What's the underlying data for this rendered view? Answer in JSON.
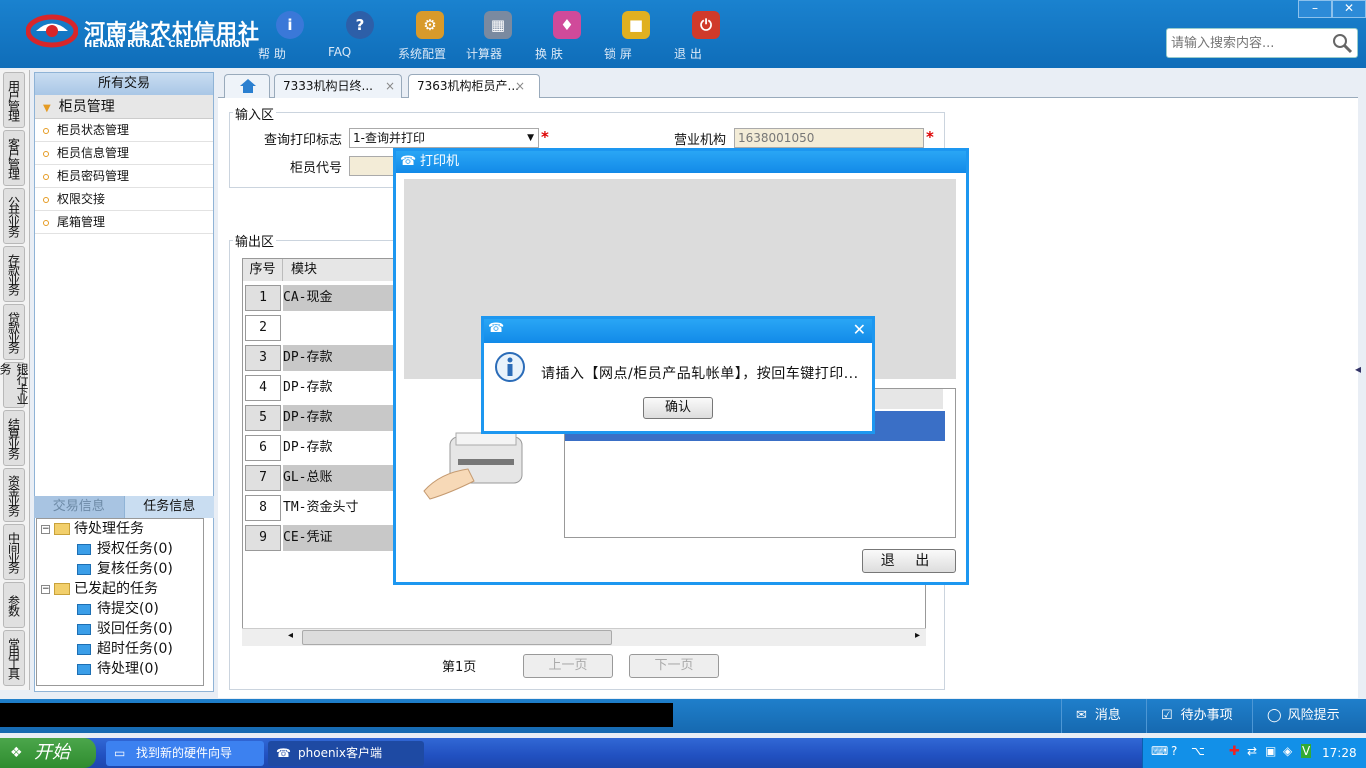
{
  "header": {
    "logo_cn": "河南省农村信用社",
    "logo_en": "HENAN RURAL CREDIT UNION",
    "tools": [
      {
        "label": "帮 助",
        "icon": "info-icon",
        "color": "#3a78d8"
      },
      {
        "label": "FAQ",
        "icon": "question-icon",
        "color": "#2d5fa8"
      },
      {
        "label": "系统配置",
        "icon": "toolbox-icon",
        "color": "#d89a2a"
      },
      {
        "label": "计算器",
        "icon": "calculator-icon",
        "color": "#7a8aa0"
      },
      {
        "label": "换 肤",
        "icon": "shirt-icon",
        "color": "#d04a9a"
      },
      {
        "label": "锁 屏",
        "icon": "lock-icon",
        "color": "#e0b020"
      },
      {
        "label": "退 出",
        "icon": "power-icon",
        "color": "#d03a2a"
      }
    ],
    "search_placeholder": "请输入搜索内容...",
    "min_label": "–",
    "close_label": "✕"
  },
  "vnav": [
    "用户管理",
    "客户管理",
    "公共业务",
    "存款业务",
    "贷款业务",
    "银行卡业务",
    "结算业务",
    "资金业务",
    "中间业务",
    "参数",
    "常用工具"
  ],
  "left_panel": {
    "title": "所有交易",
    "group": "柜员管理",
    "items": [
      "柜员状态管理",
      "柜员信息管理",
      "柜员密码管理",
      "权限交接",
      "尾箱管理"
    ],
    "tabs": [
      "交易信息",
      "任务信息"
    ],
    "tree": {
      "pending": "待处理任务",
      "pending_children": [
        "授权任务(0)",
        "复核任务(0)"
      ],
      "initiated": "已发起的任务",
      "initiated_children": [
        "待提交(0)",
        "驳回任务(0)",
        "超时任务(0)",
        "待处理(0)"
      ]
    }
  },
  "tabs": [
    "7333机构日终...",
    "7363机构柜员产..."
  ],
  "input_area": {
    "title": "输入区",
    "print_flag_label": "查询打印标志",
    "print_flag_value": "1-查询并打印",
    "org_label": "营业机构",
    "org_value": "1638001050",
    "teller_label": "柜员代号"
  },
  "output_area": {
    "title": "输出区",
    "columns": [
      "序号",
      "模块"
    ],
    "rows": [
      {
        "no": "1",
        "module": "CA-现金"
      },
      {
        "no": "2",
        "module": ""
      },
      {
        "no": "3",
        "module": "DP-存款"
      },
      {
        "no": "4",
        "module": "DP-存款"
      },
      {
        "no": "5",
        "module": "DP-存款"
      },
      {
        "no": "6",
        "module": "DP-存款"
      },
      {
        "no": "7",
        "module": "GL-总账"
      },
      {
        "no": "8",
        "module": "TM-资金头寸"
      },
      {
        "no": "9",
        "module": "CE-凭证"
      }
    ],
    "page_text": "第1页",
    "prev": "上一页",
    "next": "下一页"
  },
  "printer_dialog": {
    "title": "打印机",
    "exit": "退 出"
  },
  "message_box": {
    "text": "请插入【网点/柜员产品轧帐单】，按回车键打印...",
    "ok": "确认"
  },
  "statusbar": {
    "messages": "消息",
    "todo": "待办事项",
    "risk": "风险提示"
  },
  "taskbar": {
    "start": "开始",
    "items": [
      "找到新的硬件向导",
      "phoenix客户端"
    ],
    "clock": "17:28"
  }
}
